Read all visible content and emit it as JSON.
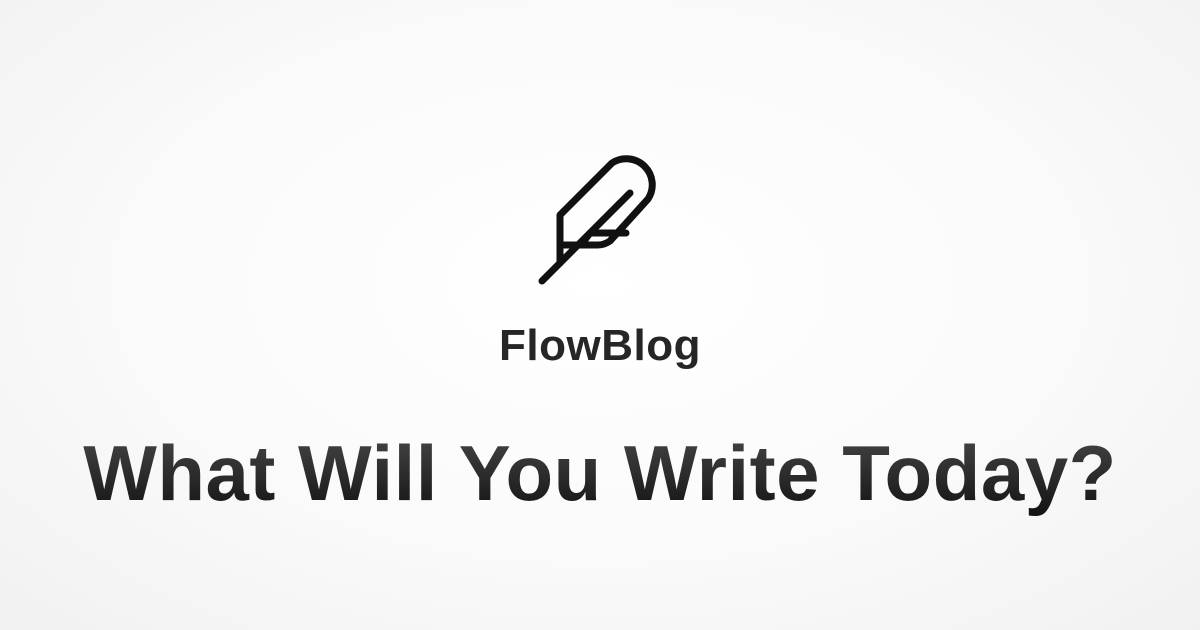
{
  "brand": {
    "logo_icon": "feather-icon",
    "name": "FlowBlog"
  },
  "headline": "What Will You Write Today?",
  "colors": {
    "icon": "#111111",
    "brand_text": "#262626",
    "headline_top": "#4a4a4a",
    "headline_bottom": "#0f0f0f",
    "background": "#fafafa"
  }
}
